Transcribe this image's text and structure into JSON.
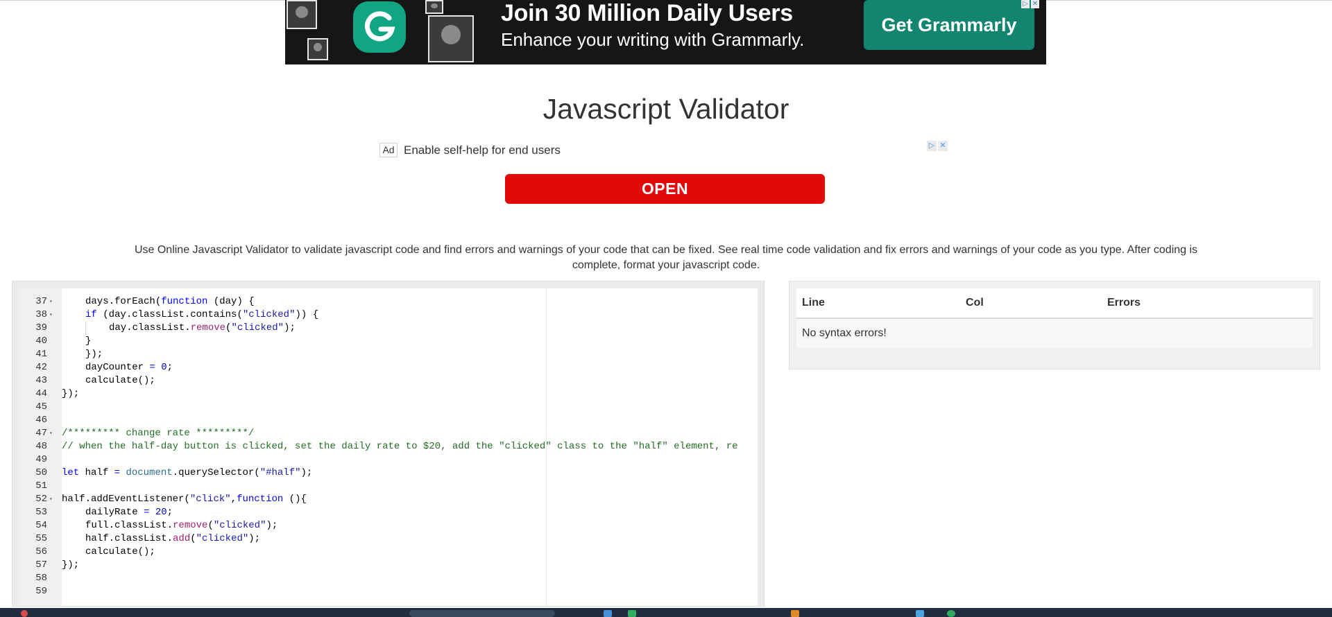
{
  "banner": {
    "headline": "Join 30 Million Daily Users",
    "subline": "Enhance your writing with Grammarly.",
    "cta": "Get Grammarly",
    "brand_color": "#11a683",
    "cta_color": "#11856e",
    "logo_icon": "grammarly-g-icon"
  },
  "page": {
    "title": "Javascript Validator",
    "description": "Use Online Javascript Validator to validate javascript code and find errors and warnings of your code that can be fixed. See real time code validation and fix errors and warnings of your code as you type. After coding is complete, format your javascript code."
  },
  "ad": {
    "badge": "Ad",
    "text": "Enable self-help for end users",
    "button": "OPEN",
    "button_color": "#e10a0a"
  },
  "editor": {
    "lines": [
      {
        "n": "37",
        "fold": true,
        "indent": 1,
        "tokens": [
          [
            "plain",
            "days.forEach("
          ],
          [
            "kw",
            "function"
          ],
          [
            "plain",
            " (day) {"
          ]
        ]
      },
      {
        "n": "38",
        "fold": true,
        "indent": 1,
        "tokens": [
          [
            "kw",
            "if"
          ],
          [
            "plain",
            " (day.classList.contains("
          ],
          [
            "str",
            "\"clicked\""
          ],
          [
            "plain",
            ")) {"
          ]
        ]
      },
      {
        "n": "39",
        "fold": false,
        "indent": 2,
        "tokens": [
          [
            "plain",
            "day.classList."
          ],
          [
            "method",
            "remove"
          ],
          [
            "plain",
            "("
          ],
          [
            "str",
            "\"clicked\""
          ],
          [
            "plain",
            ");"
          ]
        ]
      },
      {
        "n": "40",
        "fold": false,
        "indent": 1,
        "tokens": [
          [
            "plain",
            "}"
          ]
        ]
      },
      {
        "n": "41",
        "fold": false,
        "indent": 1,
        "tokens": [
          [
            "plain",
            "});"
          ]
        ]
      },
      {
        "n": "42",
        "fold": false,
        "indent": 1,
        "tokens": [
          [
            "plain",
            "dayCounter "
          ],
          [
            "kw",
            "="
          ],
          [
            "plain",
            " "
          ],
          [
            "num",
            "0"
          ],
          [
            "plain",
            ";"
          ]
        ]
      },
      {
        "n": "43",
        "fold": false,
        "indent": 1,
        "tokens": [
          [
            "plain",
            "calculate();"
          ]
        ]
      },
      {
        "n": "44",
        "fold": false,
        "indent": 0,
        "tokens": [
          [
            "plain",
            "});"
          ]
        ]
      },
      {
        "n": "45",
        "fold": false,
        "indent": 0,
        "tokens": []
      },
      {
        "n": "46",
        "fold": false,
        "indent": 0,
        "tokens": []
      },
      {
        "n": "47",
        "fold": true,
        "indent": 0,
        "tokens": [
          [
            "comment",
            "/********* change rate *********/"
          ]
        ]
      },
      {
        "n": "48",
        "fold": false,
        "indent": 0,
        "tokens": [
          [
            "comment",
            "// when the half-day button is clicked, set the daily rate to $20, add the \"clicked\" class to the \"half\" element, re"
          ]
        ]
      },
      {
        "n": "49",
        "fold": false,
        "indent": 0,
        "tokens": []
      },
      {
        "n": "50",
        "fold": false,
        "indent": 0,
        "tokens": [
          [
            "kw",
            "let"
          ],
          [
            "plain",
            " half "
          ],
          [
            "kw",
            "="
          ],
          [
            "plain",
            " "
          ],
          [
            "builtin",
            "document"
          ],
          [
            "plain",
            ".querySelector("
          ],
          [
            "str",
            "\"#half\""
          ],
          [
            "plain",
            ");"
          ]
        ]
      },
      {
        "n": "51",
        "fold": false,
        "indent": 0,
        "tokens": []
      },
      {
        "n": "52",
        "fold": true,
        "indent": 0,
        "tokens": [
          [
            "plain",
            "half.addEventListener("
          ],
          [
            "str",
            "\"click\""
          ],
          [
            "plain",
            ","
          ],
          [
            "kw",
            "function"
          ],
          [
            "plain",
            " (){"
          ]
        ]
      },
      {
        "n": "53",
        "fold": false,
        "indent": 1,
        "tokens": [
          [
            "plain",
            "dailyRate "
          ],
          [
            "kw",
            "="
          ],
          [
            "plain",
            " "
          ],
          [
            "num",
            "20"
          ],
          [
            "plain",
            ";"
          ]
        ]
      },
      {
        "n": "54",
        "fold": false,
        "indent": 1,
        "tokens": [
          [
            "plain",
            "full.classList."
          ],
          [
            "method",
            "remove"
          ],
          [
            "plain",
            "("
          ],
          [
            "str",
            "\"clicked\""
          ],
          [
            "plain",
            ");"
          ]
        ]
      },
      {
        "n": "55",
        "fold": false,
        "indent": 1,
        "tokens": [
          [
            "plain",
            "half.classList."
          ],
          [
            "method",
            "add"
          ],
          [
            "plain",
            "("
          ],
          [
            "str",
            "\"clicked\""
          ],
          [
            "plain",
            ");"
          ]
        ]
      },
      {
        "n": "56",
        "fold": false,
        "indent": 1,
        "tokens": [
          [
            "plain",
            "calculate();"
          ]
        ]
      },
      {
        "n": "57",
        "fold": false,
        "indent": 0,
        "tokens": [
          [
            "plain",
            "});"
          ]
        ]
      },
      {
        "n": "58",
        "fold": false,
        "indent": 0,
        "tokens": []
      },
      {
        "n": "59",
        "fold": false,
        "indent": 0,
        "tokens": []
      }
    ]
  },
  "errors": {
    "headers": [
      "Line",
      "Col",
      "Errors"
    ],
    "message": "No syntax errors!"
  }
}
